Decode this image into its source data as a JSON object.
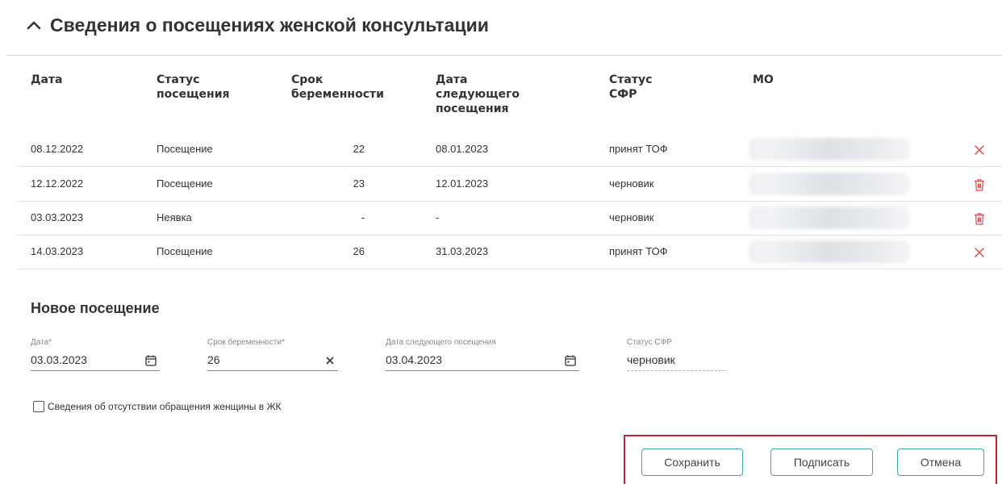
{
  "section": {
    "title": "Сведения о посещениях женской консультации"
  },
  "table": {
    "headers": {
      "date": [
        "Дата"
      ],
      "status": [
        "Статус",
        "посещения"
      ],
      "term": [
        "Срок",
        "беременности"
      ],
      "next": [
        "Дата",
        "следующего",
        "посещения"
      ],
      "sfr": [
        "Статус",
        "СФР"
      ],
      "mo": [
        "МО"
      ]
    },
    "rows": [
      {
        "date": "08.12.2022",
        "status": "Посещение",
        "term": "22",
        "next": "08.01.2023",
        "sfr": "принят ТОФ",
        "action": "close-icon"
      },
      {
        "date": "12.12.2022",
        "status": "Посещение",
        "term": "23",
        "next": "12.01.2023",
        "sfr": "черновик",
        "action": "trash-icon"
      },
      {
        "date": "03.03.2023",
        "status": "Неявка",
        "term": "-",
        "next": "-",
        "sfr": "черновик",
        "action": "trash-icon"
      },
      {
        "date": "14.03.2023",
        "status": "Посещение",
        "term": "26",
        "next": "31.03.2023",
        "sfr": "принят ТОФ",
        "action": "close-icon"
      }
    ]
  },
  "new_visit": {
    "title": "Новое посещение",
    "date": {
      "label": "Дата*",
      "value": "03.03.2023"
    },
    "term": {
      "label": "Срок беременности*",
      "value": "26"
    },
    "next_date": {
      "label": "Дата следующего посещения",
      "value": "03.04.2023"
    },
    "sfr_status": {
      "label": "Статус СФР",
      "value": "черновик"
    },
    "checkbox_label": "Сведения об отсутствии обращения женщины в ЖК",
    "checkbox_checked": false
  },
  "buttons": {
    "save": "Сохранить",
    "sign": "Подписать",
    "cancel": "Отмена"
  },
  "colors": {
    "accent": "#3fa7b5",
    "danger": "#e04848",
    "highlight_frame": "#c0282d"
  }
}
